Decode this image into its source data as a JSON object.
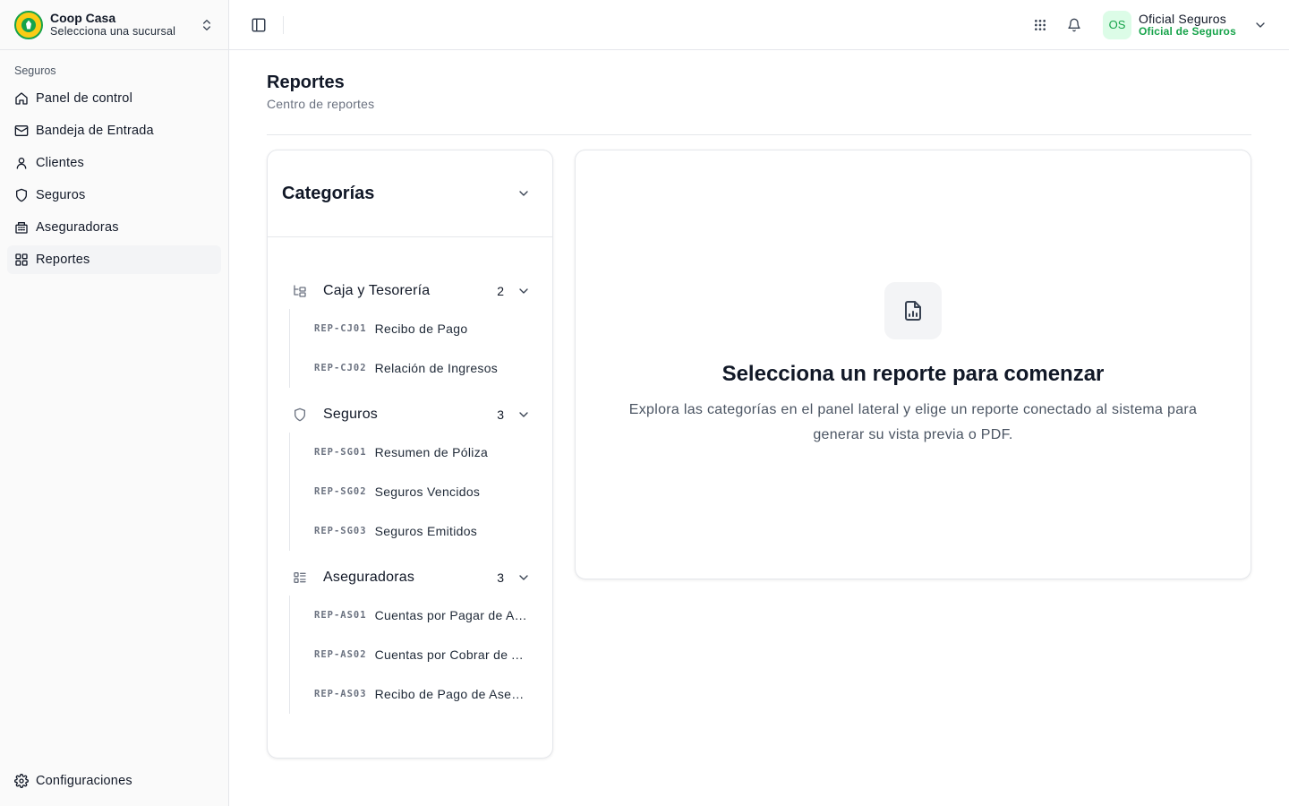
{
  "brand": {
    "title": "Coop Casa",
    "subtitle": "Selecciona una sucursal",
    "logo": "coop-casa-logo"
  },
  "sidebar": {
    "group_label": "Seguros",
    "items": [
      {
        "label": "Panel de control",
        "icon": "home-icon"
      },
      {
        "label": "Bandeja de Entrada",
        "icon": "mail-icon"
      },
      {
        "label": "Clientes",
        "icon": "user-icon"
      },
      {
        "label": "Seguros",
        "icon": "shield-icon"
      },
      {
        "label": "Aseguradoras",
        "icon": "building-icon"
      },
      {
        "label": "Reportes",
        "icon": "grid-icon",
        "active": true
      }
    ],
    "footer": {
      "label": "Configuraciones",
      "icon": "gear-icon"
    }
  },
  "topbar": {
    "user": {
      "initials": "OS",
      "name": "Oficial Seguros",
      "role": "Oficial de Seguros"
    }
  },
  "page": {
    "title": "Reportes",
    "subtitle": "Centro de reportes"
  },
  "categories": {
    "title": "Categorías",
    "groups": [
      {
        "label": "Caja y Tesorería",
        "count": "2",
        "icon": "tree-icon",
        "items": [
          {
            "code": "REP-CJ01",
            "label": "Recibo de Pago"
          },
          {
            "code": "REP-CJ02",
            "label": "Relación de Ingresos"
          }
        ]
      },
      {
        "label": "Seguros",
        "count": "3",
        "icon": "shield-icon",
        "items": [
          {
            "code": "REP-SG01",
            "label": "Resumen de Póliza"
          },
          {
            "code": "REP-SG02",
            "label": "Seguros Vencidos"
          },
          {
            "code": "REP-SG03",
            "label": "Seguros Emitidos"
          }
        ]
      },
      {
        "label": "Aseguradoras",
        "count": "3",
        "icon": "list-icon",
        "items": [
          {
            "code": "REP-AS01",
            "label": "Cuentas por Pagar de Aseguradoras"
          },
          {
            "code": "REP-AS02",
            "label": "Cuentas por Cobrar de Aseguradoras"
          },
          {
            "code": "REP-AS03",
            "label": "Recibo de Pago de Aseguradoras"
          }
        ]
      }
    ]
  },
  "preview": {
    "title": "Selecciona un reporte para comenzar",
    "description": "Explora las categorías en el panel lateral y elige un reporte conectado al sistema para generar su vista previa o PDF.",
    "icon": "file-chart-icon"
  },
  "colors": {
    "accent": "#16a34a",
    "avatar_bg": "#dcfce7",
    "logo_yellow": "#facc15"
  }
}
